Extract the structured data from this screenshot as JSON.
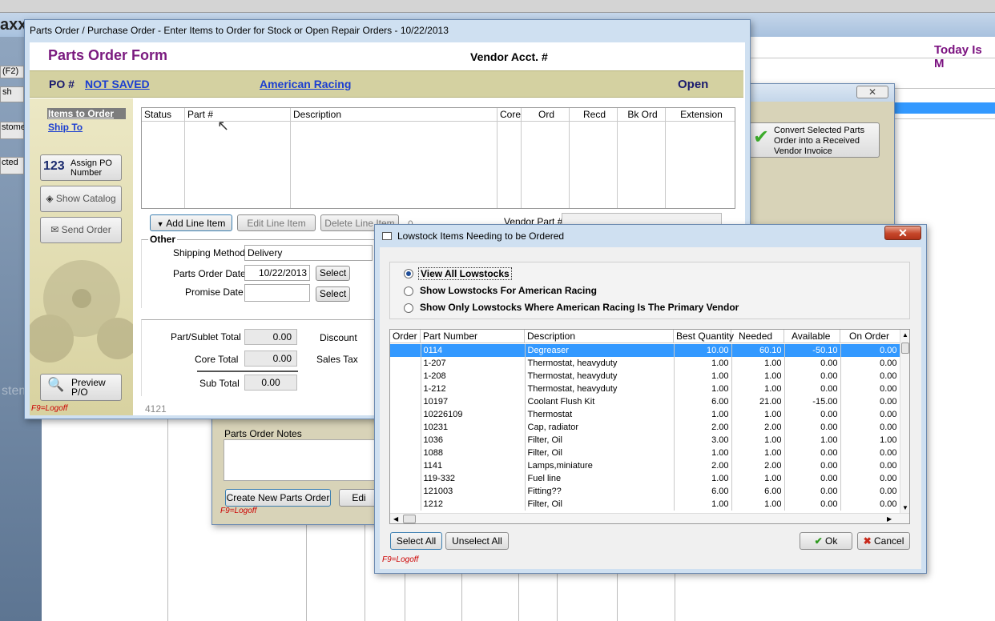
{
  "background": {
    "app_title_fragment": "axx",
    "sidebar_items": [
      "(F2)",
      "sh",
      "stome",
      "cted"
    ],
    "today_label": "Today Is M",
    "rear_logoff": "F9=Logoff",
    "convert_button_label": "Convert Selected Parts Order into a Received Vendor Invoice",
    "parts_order_notes_label": "Parts Order Notes",
    "create_new_button": "Create New Parts Order",
    "edit_button": "Edi",
    "watermark": "stems"
  },
  "parts_window": {
    "title": "Parts Order / Purchase Order - Enter Items to Order for Stock or Open Repair Orders - 10/22/2013",
    "form_title": "Parts Order Form",
    "vendor_acct_label": "Vendor Acct. #",
    "po_label": "PO #",
    "po_value": "NOT SAVED",
    "vendor_name": "American Racing",
    "status": "Open",
    "left_nav": {
      "items_to_order": "Items to Order",
      "ship_to": "Ship To"
    },
    "assign_po_icon": "123",
    "assign_po_label": "Assign PO Number",
    "show_catalog_label": "Show Catalog",
    "send_order_label": "Send Order",
    "preview_label": "Preview P/O",
    "logoff": "F9=Logoff",
    "grid_columns": [
      "Status",
      "Part #",
      "Description",
      "Core",
      "Ord",
      "Recd",
      "Bk Ord",
      "Extension"
    ],
    "add_line_item": "Add Line Item",
    "edit_line_item": "Edit Line Item",
    "delete_line_item": "Delete Line Item",
    "line_count": "0",
    "vendor_part_label": "Vendor Part #",
    "other_label": "Other",
    "shipping_method_label": "Shipping Method",
    "shipping_method_value": "Delivery",
    "parts_order_date_label": "Parts Order Date",
    "parts_order_date_value": "10/22/2013",
    "select_label": "Select",
    "promise_date_label": "Promise Date",
    "part_sublet_total_label": "Part/Sublet Total",
    "part_sublet_total_value": "0.00",
    "core_total_label": "Core Total",
    "core_total_value": "0.00",
    "sub_total_label": "Sub Total",
    "sub_total_value": "0.00",
    "discount_label": "Discount",
    "sales_tax_label": "Sales Tax",
    "footer_id": "4121"
  },
  "lowstock_dialog": {
    "title": "Lowstock Items Needing to be Ordered",
    "options": [
      {
        "label": "View All Lowstocks",
        "selected": true
      },
      {
        "label": "Show Lowstocks For American Racing",
        "selected": false
      },
      {
        "label": "Show Only Lowstocks Where American Racing Is The Primary Vendor",
        "selected": false
      }
    ],
    "columns": [
      "Order",
      "Part Number",
      "Description",
      "Best Quantity",
      "Needed",
      "Available",
      "On Order"
    ],
    "rows": [
      {
        "order": "",
        "part": "0114",
        "desc": "Degreaser",
        "best": "10.00",
        "needed": "60.10",
        "avail": "-50.10",
        "on_order": "0.00"
      },
      {
        "order": "",
        "part": "1-207",
        "desc": "Thermostat, heavyduty",
        "best": "1.00",
        "needed": "1.00",
        "avail": "0.00",
        "on_order": "0.00"
      },
      {
        "order": "",
        "part": "1-208",
        "desc": "Thermostat, heavyduty",
        "best": "1.00",
        "needed": "1.00",
        "avail": "0.00",
        "on_order": "0.00"
      },
      {
        "order": "",
        "part": "1-212",
        "desc": "Thermostat, heavyduty",
        "best": "1.00",
        "needed": "1.00",
        "avail": "0.00",
        "on_order": "0.00"
      },
      {
        "order": "",
        "part": "10197",
        "desc": "Coolant Flush Kit",
        "best": "6.00",
        "needed": "21.00",
        "avail": "-15.00",
        "on_order": "0.00"
      },
      {
        "order": "",
        "part": "10226109",
        "desc": "Thermostat",
        "best": "1.00",
        "needed": "1.00",
        "avail": "0.00",
        "on_order": "0.00"
      },
      {
        "order": "",
        "part": "10231",
        "desc": "Cap, radiator",
        "best": "2.00",
        "needed": "2.00",
        "avail": "0.00",
        "on_order": "0.00"
      },
      {
        "order": "",
        "part": "1036",
        "desc": "Filter, Oil",
        "best": "3.00",
        "needed": "1.00",
        "avail": "1.00",
        "on_order": "1.00"
      },
      {
        "order": "",
        "part": "1088",
        "desc": "Filter, Oil",
        "best": "1.00",
        "needed": "1.00",
        "avail": "0.00",
        "on_order": "0.00"
      },
      {
        "order": "",
        "part": "1141",
        "desc": "Lamps,miniature",
        "best": "2.00",
        "needed": "2.00",
        "avail": "0.00",
        "on_order": "0.00"
      },
      {
        "order": "",
        "part": "119-332",
        "desc": "Fuel line",
        "best": "1.00",
        "needed": "1.00",
        "avail": "0.00",
        "on_order": "0.00"
      },
      {
        "order": "",
        "part": "121003",
        "desc": "Fitting??",
        "best": "6.00",
        "needed": "6.00",
        "avail": "0.00",
        "on_order": "0.00"
      },
      {
        "order": "",
        "part": "1212",
        "desc": "Filter, Oil",
        "best": "1.00",
        "needed": "1.00",
        "avail": "0.00",
        "on_order": "0.00"
      }
    ],
    "select_all": "Select All",
    "unselect_all": "Unselect All",
    "ok": "Ok",
    "cancel": "Cancel",
    "logoff": "F9=Logoff"
  }
}
